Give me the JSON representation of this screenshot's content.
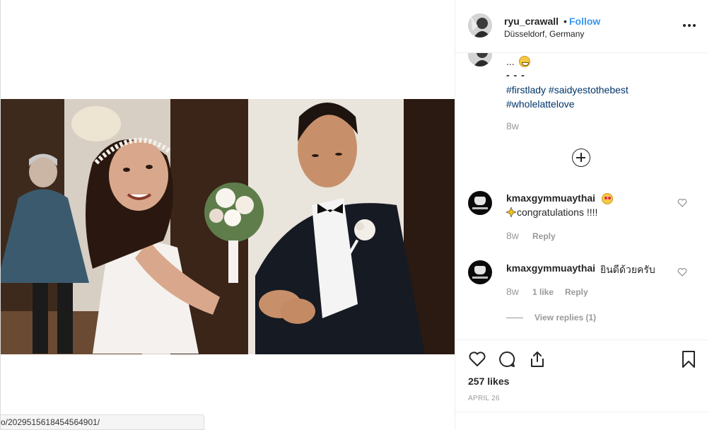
{
  "post": {
    "username": "ryu_crawall",
    "separator": "•",
    "follow_label": "Follow",
    "location": "Düsseldorf, Germany",
    "caption_ellipsis": "...",
    "caption_dashes": "- - -",
    "hashtags": [
      "#firstlady",
      "#saidyestothebest",
      "#wholelattelove"
    ],
    "caption_time": "8w"
  },
  "comments": [
    {
      "username": "kmaxgymmuaythai",
      "text": "congratulations !!!!",
      "time": "8w",
      "reply_label": "Reply"
    },
    {
      "username": "kmaxgymmuaythai",
      "text": "ยินดีด้วยครับ",
      "time": "8w",
      "likes_label": "1 like",
      "reply_label": "Reply",
      "view_replies_label": "View replies (1)"
    }
  ],
  "actions": {
    "likes": "257 likes",
    "date": "APRIL 26",
    "icons": [
      "heart-icon",
      "comment-icon",
      "share-icon",
      "bookmark-icon"
    ]
  },
  "status_bar": {
    "url_fragment": "o/2029515618454564901/"
  },
  "colors": {
    "link": "#3897f0",
    "hashtag": "#003569",
    "muted": "#999999",
    "text": "#262626"
  }
}
